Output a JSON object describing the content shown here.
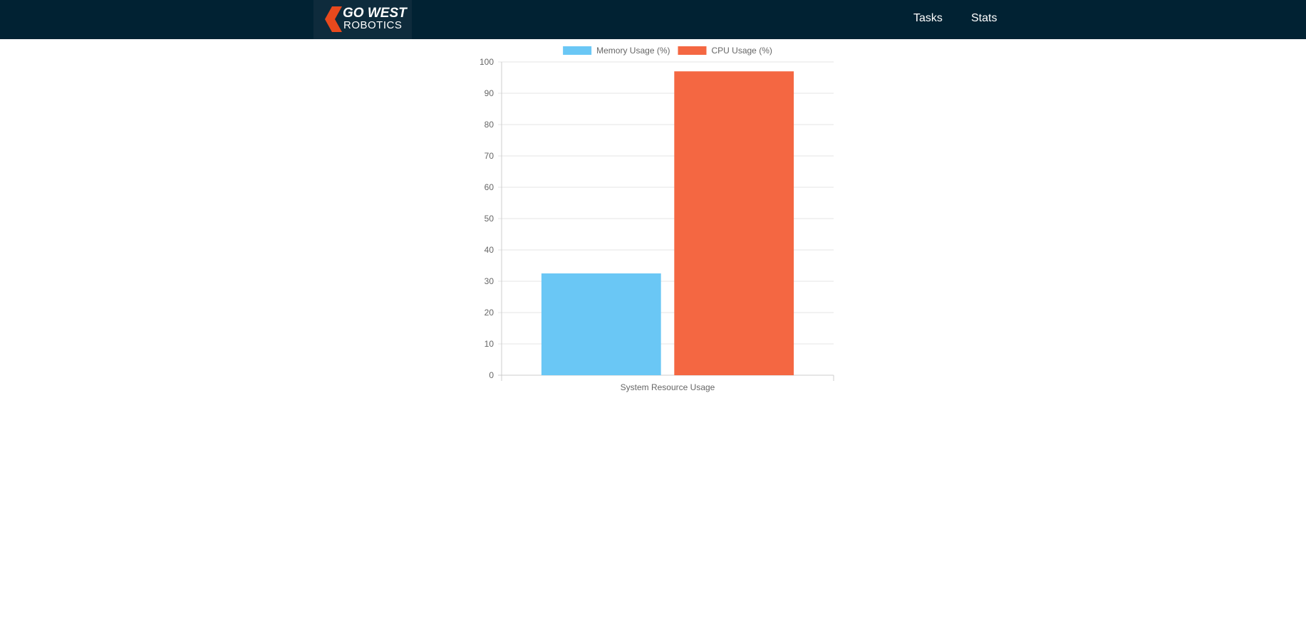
{
  "navbar": {
    "logo_line1": "GO WEST",
    "logo_line2": "ROBOTICS",
    "links": [
      {
        "label": "Tasks"
      },
      {
        "label": "Stats"
      }
    ],
    "background_color": "#012233",
    "logo_accent_color": "#e8491d"
  },
  "chart_data": {
    "type": "bar",
    "title": "",
    "categories": [
      "System Resource Usage"
    ],
    "series": [
      {
        "name": "Memory Usage (%)",
        "values": [
          32.5
        ],
        "color": "#6ac7f5"
      },
      {
        "name": "CPU Usage (%)",
        "values": [
          97
        ],
        "color": "#f46742"
      }
    ],
    "xlabel": "",
    "ylabel": "",
    "ylim": [
      0,
      100
    ],
    "yticks": [
      0,
      10,
      20,
      30,
      40,
      50,
      60,
      70,
      80,
      90,
      100
    ],
    "grid": true,
    "legend_position": "top-center"
  }
}
